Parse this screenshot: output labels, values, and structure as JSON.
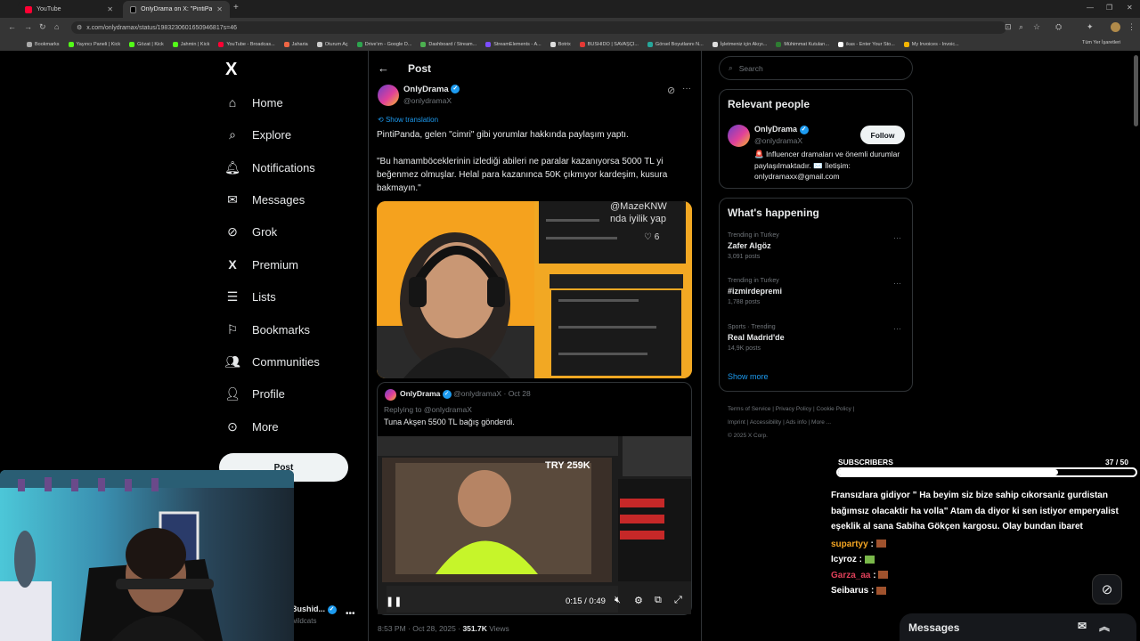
{
  "browser": {
    "tabs": [
      {
        "title": "YouTube",
        "active": false
      },
      {
        "title": "OnlyDrama on X: \"PintiPanda,",
        "active": true
      }
    ],
    "url": "x.com/onlydramax/status/1983230601650946817s=46",
    "bookmarks": [
      "Bookmarks",
      "Yayıncı Paneli | Kick",
      "Gözat | Kick",
      "Jahmin | Kick",
      "YouTube - Broadcas...",
      "Jaharia",
      "Oturum Aç",
      "Drive'ım - Google D...",
      "Dashboard / Stream...",
      "StreamElements - A...",
      "Botrix",
      "BUSHIDO | SAVAŞÇI...",
      "Görsel Boyutlannı N...",
      "İşletmeniz için Akıyı...",
      "Mühimmat Kutuları...",
      "ikas - Enter Your Sto...",
      "My Invoices - Invoic..."
    ],
    "all_bookmarks": "Tüm Yer İşaretleri"
  },
  "sidebar": {
    "logo": "X",
    "items": [
      {
        "label": "Home",
        "icon": "home-icon"
      },
      {
        "label": "Explore",
        "icon": "search-icon"
      },
      {
        "label": "Notifications",
        "icon": "bell-icon"
      },
      {
        "label": "Messages",
        "icon": "envelope-icon"
      },
      {
        "label": "Grok",
        "icon": "grok-icon"
      },
      {
        "label": "Premium",
        "icon": "x-icon"
      },
      {
        "label": "Lists",
        "icon": "list-icon"
      },
      {
        "label": "Bookmarks",
        "icon": "bookmark-icon"
      },
      {
        "label": "Communities",
        "icon": "people-icon"
      },
      {
        "label": "Profile",
        "icon": "person-icon"
      },
      {
        "label": "More",
        "icon": "more-circle-icon"
      }
    ],
    "post_button": "Post",
    "account_name": "Bushid...",
    "account_handle": "wildcats"
  },
  "post": {
    "header": "Post",
    "author_name": "OnlyDrama",
    "author_handle": "@onlydramaX",
    "show_translation": "Show translation",
    "text1": "PintiPanda, gelen \"cimri\" gibi yorumlar hakkında paylaşım yaptı.",
    "text2": "\"Bu hamamböceklerinin izlediği abileri ne paralar kazanıyorsa 5000 TL yi beğenmez olmuşlar. Helal para kazanınca 50K çıkmıyor kardeşim, kusura bakmayın.\"",
    "image_overlay_handle": "@MazeKNW",
    "image_overlay_text": "nda iyilik yap",
    "image_like_count": "6",
    "quote": {
      "author_name": "OnlyDrama",
      "author_handle": "@onlydramaX",
      "date": "Oct 28",
      "replying": "Replying to @onlydramaX",
      "text": "Tuna Akşen 5500 TL bağış gönderdi.",
      "video_overlay": "TRY 259K",
      "video_time": "0:15 / 0:49"
    },
    "timestamp": "8:53 PM · Oct 28, 2025 · ",
    "views": "351.7K",
    "views_label": " Views"
  },
  "right": {
    "search_placeholder": "Search",
    "relevant_title": "Relevant people",
    "person_name": "OnlyDrama",
    "person_handle": "@onlydramaX",
    "follow": "Follow",
    "person_bio": "🚨 Influencer dramaları ve önemli durumlar paylaşılmaktadır. ✉️ İletişim: onlydramaxx@gmail.com",
    "happening_title": "What's happening",
    "trends": [
      {
        "category": "Trending in Turkey",
        "name": "Zafer Algöz",
        "count": "3,091 posts"
      },
      {
        "category": "Trending in Turkey",
        "name": "#izmirdepremi",
        "count": "1,788 posts"
      },
      {
        "category": "Sports · Trending",
        "name": "Real Madrid'de",
        "count": "14,9K posts"
      }
    ],
    "show_more": "Show more",
    "footer": [
      "Terms of Service",
      "Privacy Policy",
      "Cookie Policy",
      "Imprint",
      "Accessibility",
      "Ads info",
      "More ...",
      "© 2025 X Corp."
    ]
  },
  "overlay": {
    "subscribers_label": "SUBSCRIBERS",
    "subscribers_count": "37 / 50",
    "subscribers_progress": 0.74,
    "chat_text": "Fransızlara gidiyor \" Ha beyim siz bize sahip cıkorsaniz gurdistan bağımsız olacaktir ha volla\" Atam da diyor ki sen istiyor emperyalist eşeklik al sana Sabiha Gökçen kargosu. Olay bundan ibaret",
    "chat_users": [
      {
        "name": "supartyy",
        "color": "#f5a623"
      },
      {
        "name": "Icyroz",
        "color": "#ffffff"
      },
      {
        "name": "Garza_aa",
        "color": "#e0405a"
      },
      {
        "name": "Seibarus",
        "color": "#ffffff"
      }
    ],
    "messages_label": "Messages"
  }
}
